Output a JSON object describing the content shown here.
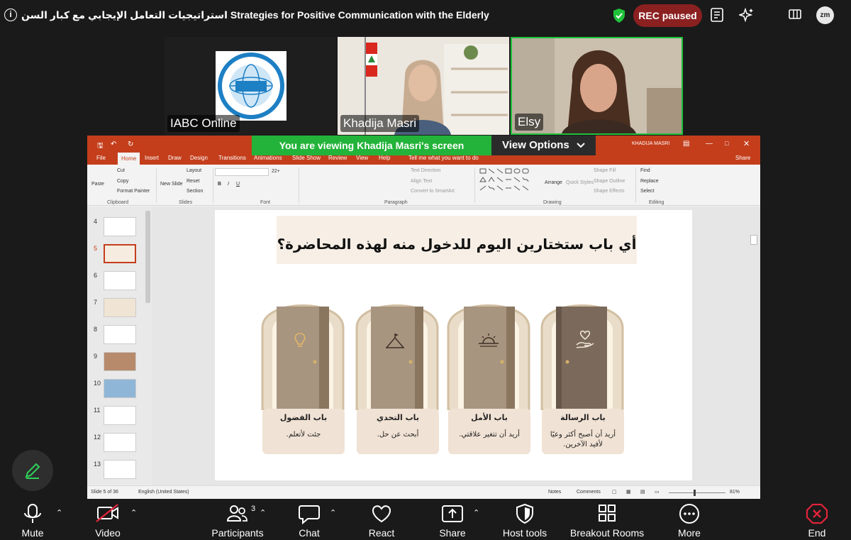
{
  "topbar": {
    "meeting_title": "استراتيجيات التعامل الإيجابي مع كبار السن Strategies for Positive Communication with the Elderly",
    "rec_status": "REC paused",
    "avatar_text": "zm"
  },
  "participants": [
    {
      "name": "IABC Online"
    },
    {
      "name": "Khadija Masri"
    },
    {
      "name": "Elsy"
    }
  ],
  "share": {
    "viewing_text": "You are viewing  Khadija Masri's screen",
    "view_options": "View Options"
  },
  "ppt": {
    "user": "KHADIJA MASRI",
    "share_label": "Share",
    "menu": [
      "File",
      "Home",
      "Insert",
      "Draw",
      "Design",
      "Transitions",
      "Animations",
      "Slide Show",
      "Review",
      "View",
      "Help"
    ],
    "tell_me": "Tell me what you want to do",
    "ribbon": {
      "paste": "Paste",
      "cut": "Cut",
      "copy": "Copy",
      "format_painter": "Format Painter",
      "new_slide": "New Slide",
      "layout": "Layout",
      "reset": "Reset",
      "section": "Section",
      "text_direction": "Text Direction",
      "align_text": "Align Text",
      "smartart": "Convert to SmartArt",
      "arrange": "Arrange",
      "quick_styles": "Quick Styles",
      "shape_fill": "Shape Fill",
      "shape_outline": "Shape Outline",
      "shape_effects": "Shape Effects",
      "find": "Find",
      "replace": "Replace",
      "select": "Select",
      "font_size": "22+",
      "groups": [
        "Clipboard",
        "Slides",
        "Font",
        "Paragraph",
        "Drawing",
        "Editing"
      ]
    },
    "thumb_numbers": [
      "4",
      "5",
      "6",
      "7",
      "8",
      "9",
      "10",
      "11",
      "12",
      "13"
    ],
    "active_slide": "5",
    "slide": {
      "heading": "أي باب ستختارين اليوم للدخول منه لهذه المحاضرة؟",
      "doors": [
        {
          "title": "باب الرسالة",
          "text": "أريد أن أصبح أكثر وعيًا لأفيد الآخرين.",
          "icon": "heart-hand-icon"
        },
        {
          "title": "باب الأمل",
          "text": "أريد أن تتغير علاقتي.",
          "icon": "sunrise-icon"
        },
        {
          "title": "باب التحدي",
          "text": "أبحث عن حل.",
          "icon": "mountain-flag-icon"
        },
        {
          "title": "باب الفضول",
          "text": "جئت لأتعلم.",
          "icon": "lightbulb-icon"
        }
      ]
    },
    "status": {
      "slide_counter": "Slide 5 of 36",
      "language": "English (United States)",
      "notes": "Notes",
      "comments": "Comments",
      "zoom": "81%"
    }
  },
  "toolbar": {
    "mute": "Mute",
    "video": "Video",
    "participants": "Participants",
    "participant_count": "3",
    "chat": "Chat",
    "react": "React",
    "share": "Share",
    "host_tools": "Host tools",
    "breakout_rooms": "Breakout Rooms",
    "more": "More",
    "end": "End"
  },
  "colors": {
    "rec_badge": "#8b2020",
    "viewing_banner": "#23b33a",
    "ppt_accent": "#c43e1c",
    "active_speaker": "#1fc23a",
    "end_icon": "#e0243a"
  }
}
